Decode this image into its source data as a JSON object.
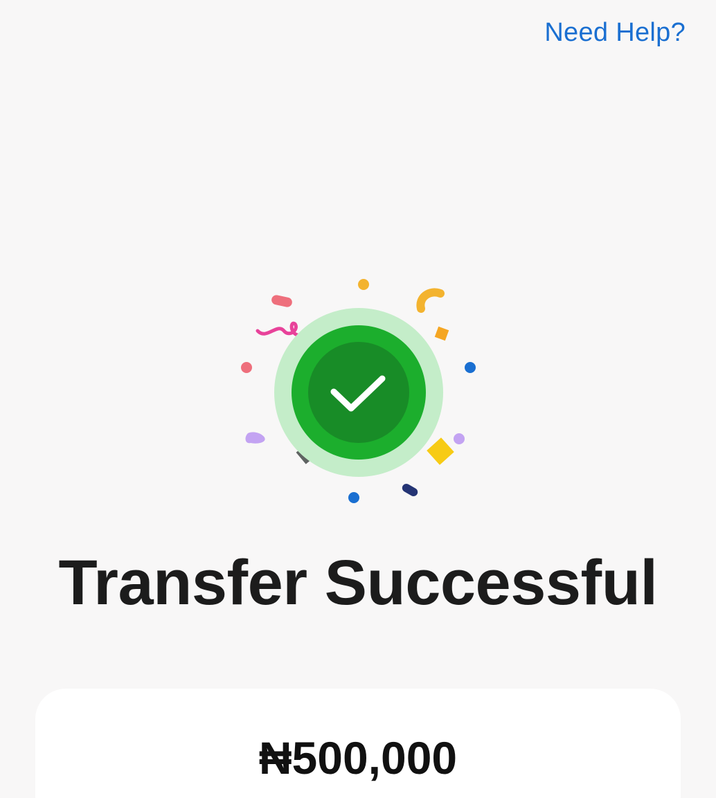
{
  "header": {
    "help_label": "Need Help?"
  },
  "status": {
    "icon": "check-circle-icon",
    "title": "Transfer Successful"
  },
  "summary": {
    "amount": "₦500,000"
  },
  "colors": {
    "accent": "#1a6fd1",
    "success_outer": "#c4edc9",
    "success_ring": "#1cae2d",
    "success_inner": "#188c27",
    "title_text": "#1c1c1c"
  }
}
